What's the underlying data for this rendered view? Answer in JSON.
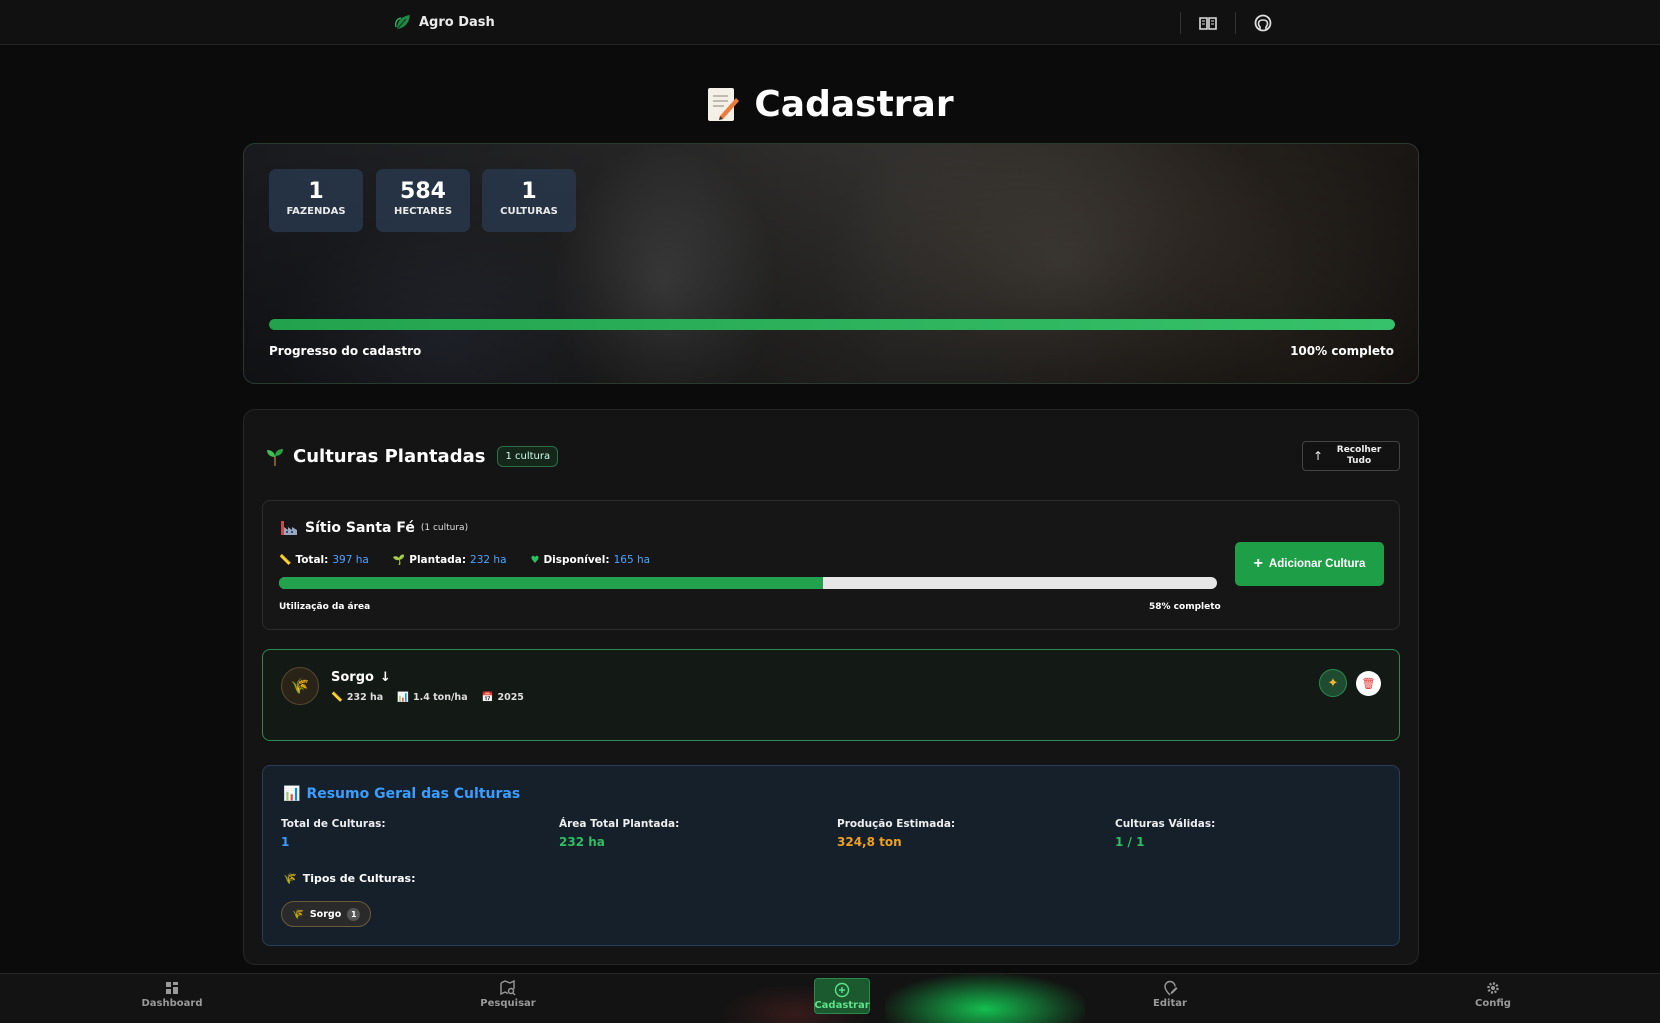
{
  "app": {
    "brand": "Agro Dash"
  },
  "page": {
    "title": "Cadastrar"
  },
  "hero": {
    "stats": [
      {
        "value": "1",
        "label": "FAZENDAS"
      },
      {
        "value": "584",
        "label": "HECTARES"
      },
      {
        "value": "1",
        "label": "CULTURAS"
      }
    ],
    "progress_label": "Progresso do cadastro",
    "progress_text": "100% completo",
    "progress_value": 1.0
  },
  "culturas": {
    "title": "Culturas Plantadas",
    "count_badge": "1 cultura",
    "collapse_label": "Recolher Tudo",
    "farm": {
      "name": "Sítio Santa Fé",
      "sub": "(1 cultura)",
      "total_label": "Total:",
      "total_value": "397 ha",
      "planted_label": "Plantada:",
      "planted_value": "232 ha",
      "available_label": "Disponível:",
      "available_value": "165 ha",
      "usage_label": "Utilização da área",
      "usage_text": "58% completo",
      "usage_value": 0.58,
      "add_button": "Adicionar Cultura"
    },
    "crop": {
      "name": "Sorgo",
      "area": "232 ha",
      "yield": "1.4 ton/ha",
      "year": "2025"
    }
  },
  "summary": {
    "title": "Resumo Geral das Culturas",
    "items": [
      {
        "label": "Total de Culturas:",
        "value": "1",
        "color": "#3a9dff"
      },
      {
        "label": "Área Total Plantada:",
        "value": "232 ha",
        "color": "#2fbf63"
      },
      {
        "label": "Produção Estimada:",
        "value": "324,8 ton",
        "color": "#f0a020"
      },
      {
        "label": "Culturas Válidas:",
        "value": "1 / 1",
        "color": "#2fbf63"
      }
    ],
    "types_label": "Tipos de Culturas:",
    "type_chip": {
      "name": "Sorgo",
      "count": "1"
    }
  },
  "nav": {
    "items": [
      {
        "label": "Dashboard",
        "icon": "grid-icon"
      },
      {
        "label": "Pesquisar",
        "icon": "map-search-icon"
      },
      {
        "label": "Cadastrar",
        "icon": "plus-circle-icon"
      },
      {
        "label": "Editar",
        "icon": "edit-pin-icon"
      },
      {
        "label": "Config",
        "icon": "gear-icon"
      }
    ],
    "active": "Cadastrar"
  },
  "colors": {
    "accent": "#23a24d",
    "link": "#4fa3ff",
    "background": "#0b0b0b"
  }
}
